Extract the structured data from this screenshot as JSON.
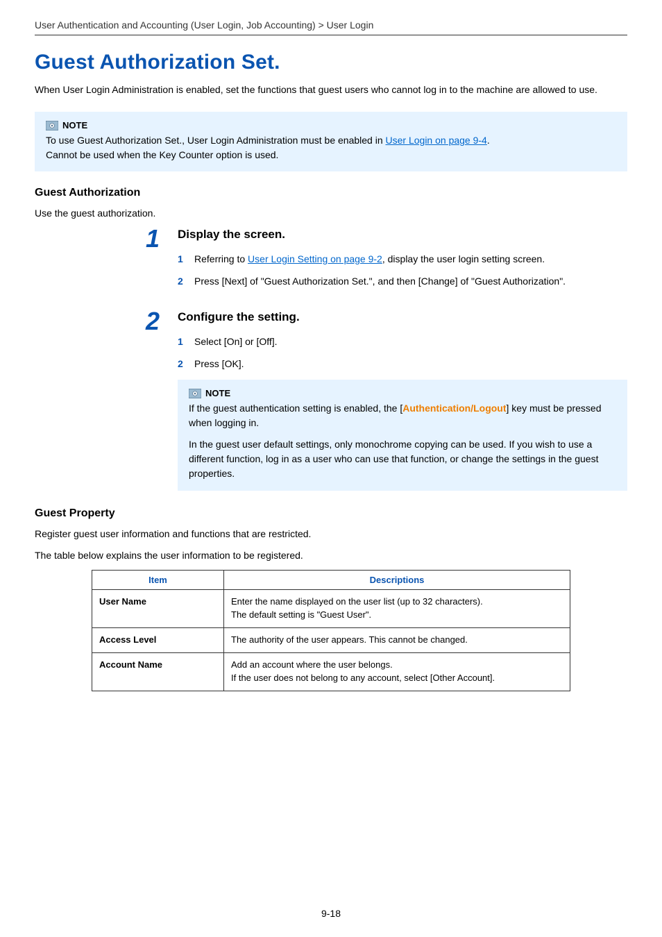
{
  "breadcrumb": "User Authentication and Accounting (User Login, Job Accounting) > User Login",
  "title": "Guest Authorization Set.",
  "intro": "When User Login Administration is enabled, set the functions that guest users who cannot log in to the machine are allowed to use.",
  "note1": {
    "label": "NOTE",
    "line1_pre": "To use Guest Authorization Set., User Login Administration must be enabled in ",
    "line1_link": "User Login on page 9-4",
    "line1_post": ".",
    "line2": "Cannot be used when the Key Counter option is used."
  },
  "section_auth": {
    "heading": "Guest Authorization",
    "lead": "Use the guest authorization."
  },
  "step1": {
    "num": "1",
    "title": "Display the screen.",
    "items": {
      "i1": {
        "n": "1",
        "pre": "Referring to ",
        "link": "User Login Setting on page 9-2",
        "post": ", display the user login setting screen."
      },
      "i2": {
        "n": "2",
        "text": "Press [Next] of \"Guest Authorization Set.\", and then [Change] of \"Guest Authorization\"."
      }
    }
  },
  "step2": {
    "num": "2",
    "title": "Configure the setting.",
    "items": {
      "i1": {
        "n": "1",
        "text": "Select [On] or [Off]."
      },
      "i2": {
        "n": "2",
        "text": "Press [OK]."
      }
    },
    "note": {
      "label": "NOTE",
      "p1_pre": "If the guest authentication setting is enabled, the [",
      "p1_key": "Authentication/Logout",
      "p1_post": "] key must be pressed when logging in.",
      "p2": "In the guest user default settings, only monochrome copying can be used. If you wish to use a different function, log in as a user who can use that function, or change the settings in the guest properties."
    }
  },
  "section_prop": {
    "heading": "Guest Property",
    "lead1": "Register guest user information and functions that are restricted.",
    "lead2": "The table below explains the user information to be registered."
  },
  "table": {
    "h_item": "Item",
    "h_desc": "Descriptions",
    "rows": {
      "r1": {
        "item": "User Name",
        "l1": "Enter the name displayed on the user list (up to 32 characters).",
        "l2": "The default setting is \"Guest User\"."
      },
      "r2": {
        "item": "Access Level",
        "l1": "The authority of the user appears. This cannot be changed."
      },
      "r3": {
        "item": "Account Name",
        "l1": "Add an account where the user belongs.",
        "l2": "If the user does not belong to any account, select [Other Account]."
      }
    }
  },
  "page_number": "9-18"
}
